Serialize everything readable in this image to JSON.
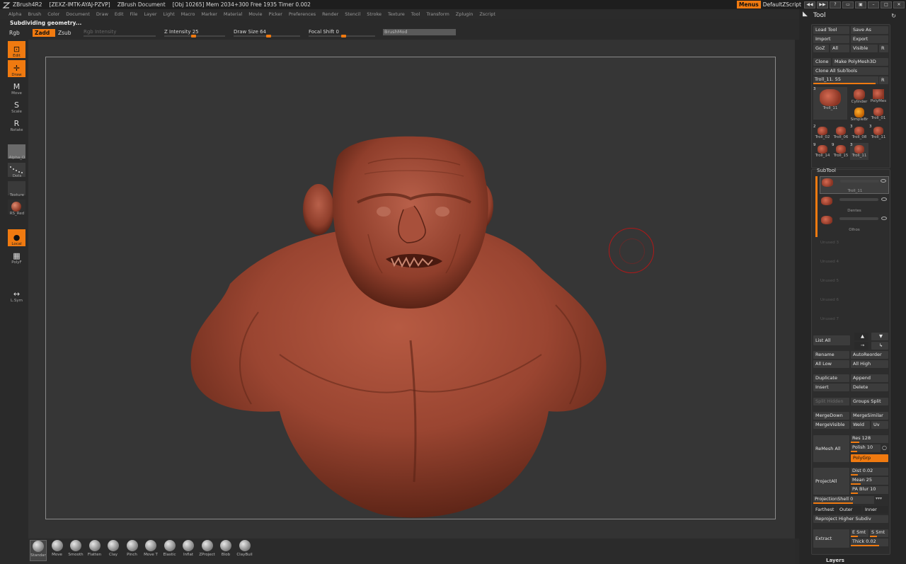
{
  "titlebar": {
    "app": "ZBrush4R2",
    "id": "[ZEXZ-IMTK-AYAJ-PZVP]",
    "doc": "ZBrush Document",
    "stats": "[Obj 10265] Mem 2034+300 Free 1935 Timer 0.002",
    "menus_label": "Menus",
    "script_label": "DefaultZScript"
  },
  "menubar": [
    "Alpha",
    "Brush",
    "Color",
    "Document",
    "Draw",
    "Edit",
    "File",
    "Layer",
    "Light",
    "Macro",
    "Marker",
    "Material",
    "Movie",
    "Picker",
    "Preferences",
    "Render",
    "Stencil",
    "Stroke",
    "Texture",
    "Tool",
    "Transform",
    "Zplugin",
    "Zscript"
  ],
  "status": "Subdividing geometry...",
  "toprow": {
    "rgb": "Rgb",
    "zadd": "Zadd",
    "zsub": "Zsub",
    "rgb_intensity": "Rgb Intensity",
    "z_intensity": "Z Intensity 25",
    "draw_size": "Draw Size 64",
    "focal_shift": "Focal Shift 0",
    "brushmod": "BrushMod"
  },
  "leftshelf": {
    "edit": "Edit",
    "draw": "Draw",
    "move": "Move",
    "scale": "Scale",
    "rotate": "Rotate",
    "alpha": "Alpha_O",
    "dots": "Dots",
    "texture": "Texture",
    "material": "RS_Red",
    "local": "Local",
    "polyf": "PolyF",
    "lsym": "L.Sym"
  },
  "bottom_brushes": [
    "Standar",
    "Move",
    "Smooth",
    "Flatten",
    "Clay",
    "Pinch",
    "Move T",
    "Elastic",
    "Inflat",
    "ZProject",
    "Blob",
    "ClayBuil"
  ],
  "tool": {
    "title": "Tool",
    "load": "Load Tool",
    "save": "Save As",
    "import": "Import",
    "export": "Export",
    "goz": "GoZ",
    "all": "All",
    "visible": "Visible",
    "r": "R",
    "clone": "Clone",
    "make_polymesh": "Make PolyMesh3D",
    "clone_all": "Clone All SubTools",
    "current": "Troll_11. 55",
    "thumbs": [
      {
        "name": "Troll_11",
        "count": "3"
      },
      {
        "name": "Cylinder",
        "count": ""
      },
      {
        "name": "PolyMes",
        "count": ""
      },
      {
        "name": "SimpleBr",
        "count": ""
      },
      {
        "name": "Troll_01",
        "count": ""
      },
      {
        "name": "Troll_02",
        "count": "2"
      },
      {
        "name": "Troll_06",
        "count": ""
      },
      {
        "name": "Troll_08",
        "count": "3"
      },
      {
        "name": "Troll_11",
        "count": "3"
      },
      {
        "name": "Troll_14",
        "count": "9"
      },
      {
        "name": "Troll_15",
        "count": "9"
      },
      {
        "name": "Troll_11",
        "count": "3"
      }
    ]
  },
  "subtool": {
    "title": "SubTool",
    "items": [
      "Troll_11",
      "Dentes",
      "Olhos"
    ],
    "slots": [
      "Unused 3",
      "Unused 4",
      "Unused 5",
      "Unused 6",
      "Unused 7"
    ],
    "list_all": "List All",
    "rename": "Rename",
    "autoreorder": "AutoReorder",
    "all_low": "All Low",
    "all_high": "All High",
    "duplicate": "Duplicate",
    "append": "Append",
    "insert": "Insert",
    "delete": "Delete",
    "split_hidden": "Split Hidden",
    "groups_split": "Groups Split",
    "mergedown": "MergeDown",
    "mergesimilar": "MergeSimilar",
    "mergevisible": "MergeVisible",
    "weld": "Weld",
    "uv": "Uv",
    "remesh_all": "ReMesh All",
    "res": "Res 128",
    "polish": "Polish 10",
    "polygrp": "PolyGrp",
    "projectall": "ProjectAll",
    "dist": "Dist 0.02",
    "mean": "Mean 25",
    "pa_blur": "PA Blur 10",
    "projectionshell": "ProjectionShell 0",
    "farthest": "Farthest",
    "outer": "Outer",
    "inner": "Inner",
    "reproject": "Reproject Higher Subdiv",
    "extract": "Extract",
    "e_smt": "E Smt",
    "s_smt": "S Smt",
    "thick": "Thick 0.02",
    "layers": "Layers"
  }
}
